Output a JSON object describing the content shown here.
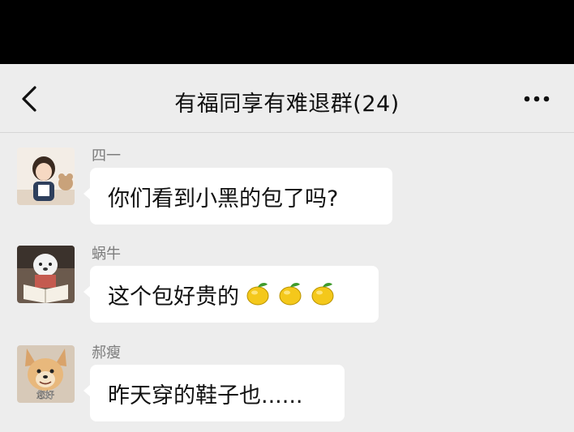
{
  "header": {
    "title": "有福同享有难退群(24)"
  },
  "messages": [
    {
      "sender": "四一",
      "text": "你们看到小黑的包了吗?"
    },
    {
      "sender": "蜗牛",
      "text": "这个包好贵的",
      "emoji": [
        "lemon",
        "lemon",
        "lemon"
      ]
    },
    {
      "sender": "郝瘦",
      "text": "昨天穿的鞋子也......",
      "avatar_text": "您好"
    }
  ],
  "colors": {
    "background": "#ededed",
    "bubble": "#ffffff",
    "status_bar": "#000000"
  }
}
